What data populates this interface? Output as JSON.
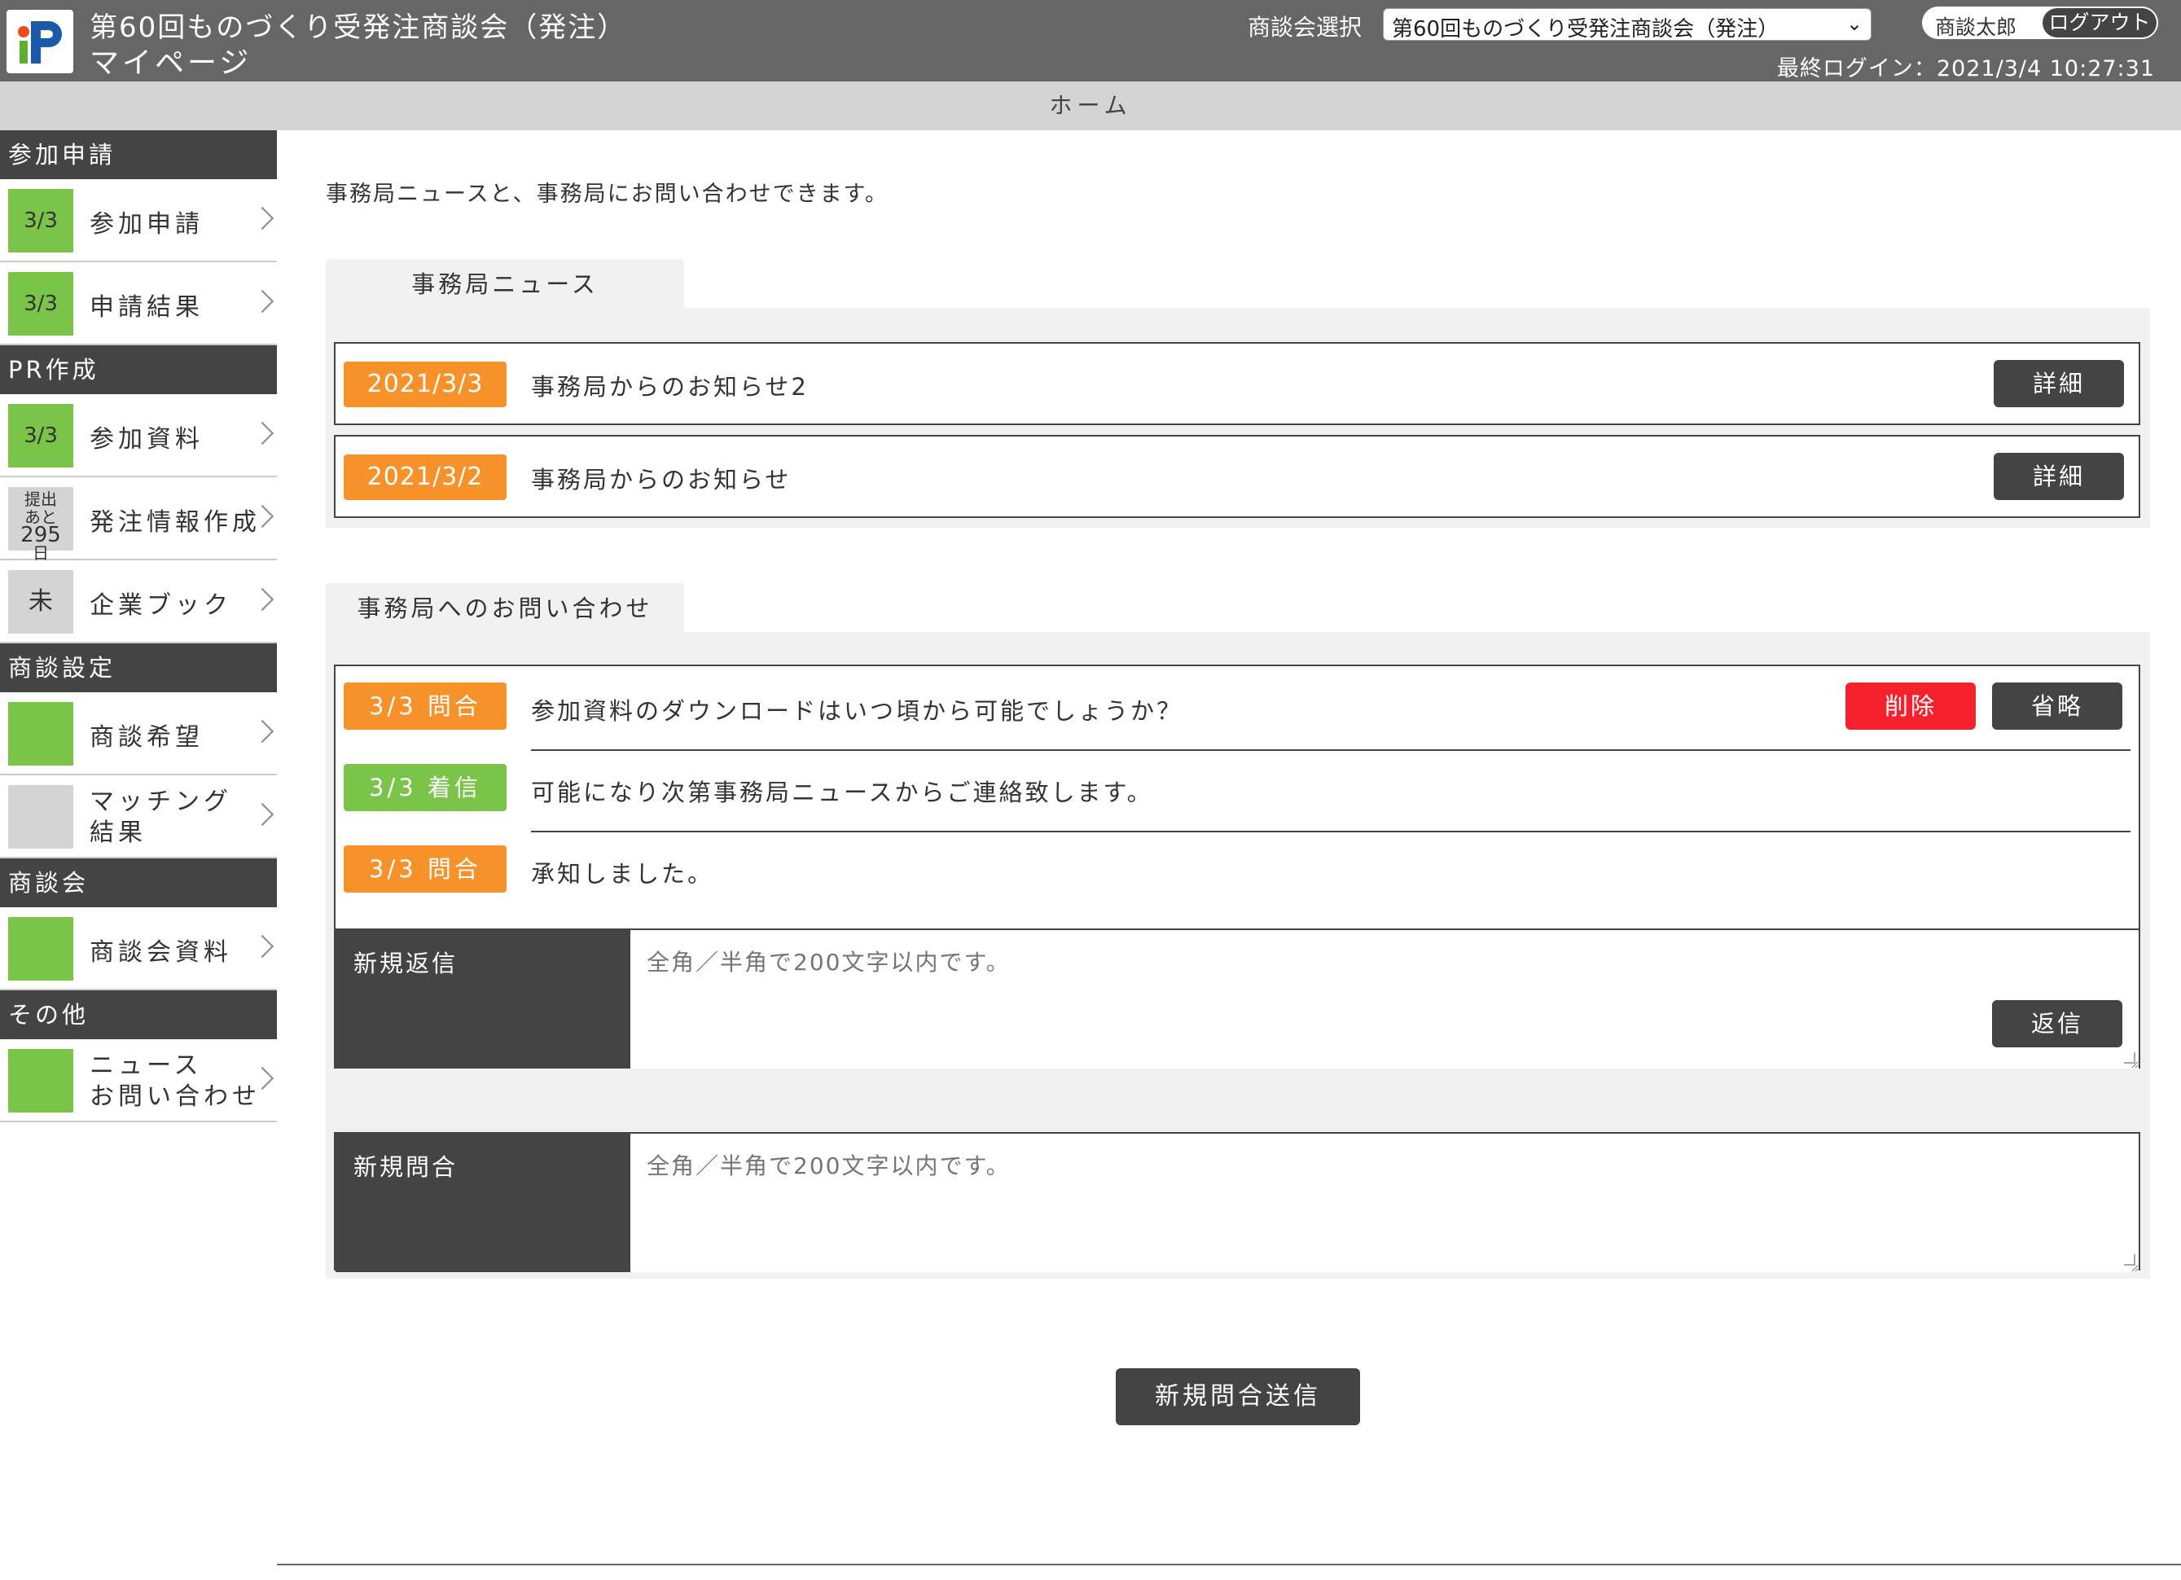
{
  "header": {
    "title_line1": "第60回ものづくり受発注商談会（発注）",
    "title_line2": "マイページ",
    "select_label": "商談会選択",
    "select_value": "第60回ものづくり受発注商談会（発注）",
    "user_name": "商談太郎",
    "logout_label": "ログアウト",
    "last_login": "最終ログイン：2021/3/4 10:27:31"
  },
  "breadcrumb": {
    "label": "ホーム"
  },
  "sidebar": {
    "sections": [
      {
        "title": "参加申請",
        "items": [
          {
            "badge": "3/3",
            "label": "参加申請",
            "status": "green"
          },
          {
            "badge": "3/3",
            "label": "申請結果",
            "status": "green"
          }
        ]
      },
      {
        "title": "PR作成",
        "items": [
          {
            "badge": "3/3",
            "label": "参加資料",
            "status": "green"
          },
          {
            "badge": "提出あと295日",
            "label": "発注情報作成",
            "status": "gray"
          },
          {
            "badge": "未",
            "label": "企業ブック",
            "status": "gray"
          }
        ]
      },
      {
        "title": "商談設定",
        "items": [
          {
            "badge": "",
            "label": "商談希望",
            "status": "green"
          },
          {
            "badge": "",
            "label": "マッチング結果",
            "status": "gray"
          }
        ]
      },
      {
        "title": "商談会",
        "items": [
          {
            "badge": "",
            "label": "商談会資料",
            "status": "green"
          }
        ]
      },
      {
        "title": "その他",
        "items": [
          {
            "badge": "",
            "label": "ニュースお問い合わせ",
            "status": "green"
          }
        ]
      }
    ],
    "badge_small_line1": "提出",
    "badge_small_line2": "あと",
    "badge_small_line3": "295",
    "badge_small_line4": "日",
    "label_matching_1": "マッチング",
    "label_matching_2": "結果",
    "label_news_1": "ニュース",
    "label_news_2": "お問い合わせ"
  },
  "main": {
    "intro": "事務局ニュースと、事務局にお問い合わせできます。",
    "news_tab": "事務局ニュース",
    "news": [
      {
        "date": "2021/3/3",
        "title": "事務局からのお知らせ2",
        "button": "詳細"
      },
      {
        "date": "2021/3/2",
        "title": "事務局からのお知らせ",
        "button": "詳細"
      }
    ],
    "inquiry_tab": "事務局へのお問い合わせ",
    "thread": [
      {
        "tag": "3/3 問合",
        "type": "問合",
        "text": "参加資料のダウンロードはいつ頃から可能でしょうか？"
      },
      {
        "tag": "3/3 着信",
        "type": "着信",
        "text": "可能になり次第事務局ニュースからご連絡致します。"
      },
      {
        "tag": "3/3 問合",
        "type": "問合",
        "text": "承知しました。"
      }
    ],
    "delete_button": "削除",
    "collapse_button": "省略",
    "reply_label": "新規返信",
    "reply_placeholder": "全角／半角で200文字以内です。",
    "reply_button": "返信",
    "new_inquiry_label": "新規問合",
    "new_inquiry_placeholder": "全角／半角で200文字以内です。",
    "send_button": "新規問合送信"
  },
  "colors": {
    "header_bg": "#666666",
    "accent_orange": "#f7922a",
    "accent_green": "#7ac44a",
    "danger_red": "#f5222d",
    "dark_button": "#444444"
  }
}
